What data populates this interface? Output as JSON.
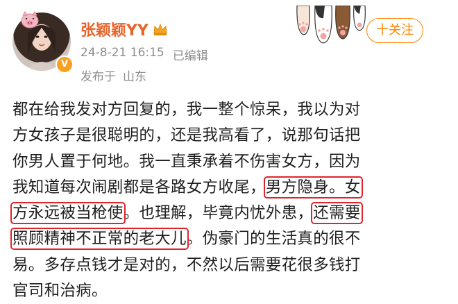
{
  "author": {
    "name": "张颖颖YY",
    "verified_badge": "V",
    "brand_color": "#e8642a"
  },
  "post_meta": {
    "date": "24-8-21 16:15",
    "edited_label": "已编辑",
    "published_prefix": "发布于",
    "location": "山东"
  },
  "follow_button": {
    "label": "十关注",
    "color": "#ff8200"
  },
  "decorations": {
    "paws_icon": "cat-paws-icon",
    "crown_icon": "crown-icon",
    "pig_icon": "pig-icon"
  },
  "post": {
    "lines": [
      [
        "都在给我发对方回复的，我一整个惊呆，我以为对"
      ],
      [
        "方女孩子是很聪明的，还是我高看了，说那句话把"
      ],
      [
        "你男人置于何地。我一直秉承着不伤害女方，因为"
      ],
      [
        "我知道每次闹剧都是各路女方收尾，",
        "男方隐身。女"
      ],
      [
        "方永远被当枪使",
        "。也理解，毕竟内忧外患，",
        "还需要"
      ],
      [
        "照顾精神不正常的老大儿",
        "。伪豪门的生活真的很不"
      ],
      [
        "易。多存点钱才是对的，不然以后需要花很多钱打"
      ],
      [
        "官司和治病。"
      ]
    ],
    "highlight_color": "#e0242c"
  }
}
